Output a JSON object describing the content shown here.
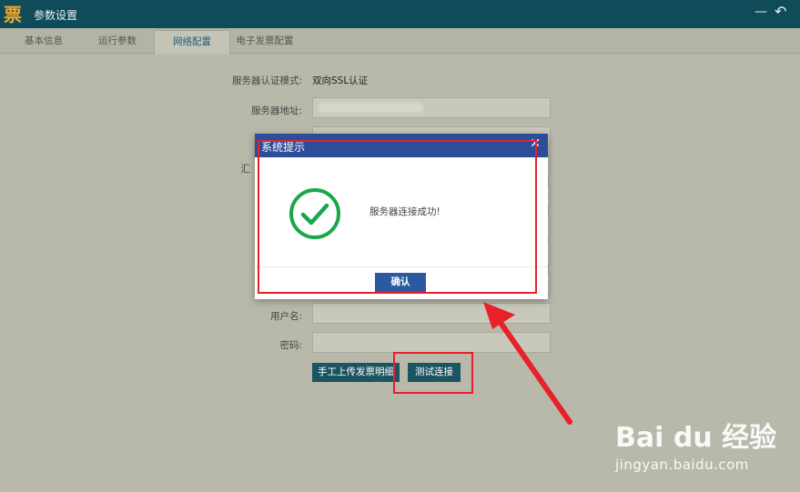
{
  "window": {
    "title": "参数设置",
    "logo_char": "票",
    "minimize_glyph": "—",
    "back_glyph": "↶"
  },
  "tabs": [
    {
      "label": "基本信息"
    },
    {
      "label": "运行参数"
    },
    {
      "label": "网络配置",
      "active": true
    },
    {
      "label": "电子发票配置"
    }
  ],
  "form": {
    "auth_mode_label": "服务器认证模式:",
    "auth_mode_value": "双向SSL认证",
    "server_address_label": "服务器地址:",
    "partial_label": "汇",
    "username_label": "用户名:",
    "password_label": "密码:"
  },
  "buttons": {
    "manual_upload": "手工上传发票明细",
    "test_connection": "测试连接"
  },
  "dialog": {
    "title": "系统提示",
    "close_glyph": "✕",
    "message": "服务器连接成功!",
    "confirm": "确认",
    "icon": "success-check-icon"
  },
  "watermark": {
    "brand": "Bai du 经验",
    "url": "jingyan.baidu.com"
  },
  "colors": {
    "titlebar": "#0f4b59",
    "background": "#b9b9ab",
    "dialog_header": "#2c4d9a",
    "success_green": "#1aa64a",
    "annotation_red": "#e8202a"
  }
}
